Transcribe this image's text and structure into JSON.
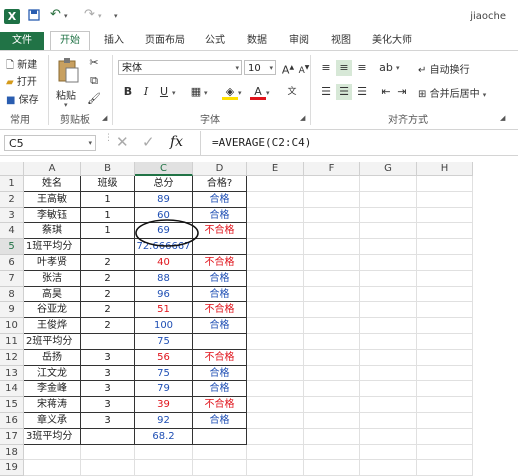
{
  "titlebar": {
    "app_icon": "X",
    "user": "jiaoche",
    "icons": [
      "excel-app-icon",
      "save-icon",
      "undo-icon",
      "redo-icon",
      "customize-qat-icon"
    ]
  },
  "tabs": [
    "文件",
    "开始",
    "插入",
    "页面布局",
    "公式",
    "数据",
    "审阅",
    "视图",
    "美化大师"
  ],
  "ribbon": {
    "new_label": "新建",
    "open_label": "打开",
    "save_label": "保存",
    "group_common": "常用",
    "paste_label": "粘贴",
    "group_clipboard": "剪贴板",
    "font_name": "宋体",
    "font_size": "10",
    "group_font": "字体",
    "wrap_label": "自动换行",
    "merge_label": "合并后居中",
    "group_alignment": "对齐方式"
  },
  "formula_bar": {
    "name_box": "C5",
    "fx": "fx",
    "formula": "=AVERAGE(C2:C4)"
  },
  "sheet": {
    "columns": [
      "A",
      "B",
      "C",
      "D",
      "E",
      "F",
      "G",
      "H"
    ],
    "selected_column": "C",
    "selected_row": 5,
    "rows": [
      {
        "n": "1",
        "a": "姓名",
        "b": "班级",
        "c": "总分",
        "d": "合格?",
        "c_color": "",
        "d_color": ""
      },
      {
        "n": "2",
        "a": "王高敏",
        "b": "1",
        "c": "89",
        "d": "合格",
        "c_color": "blue",
        "d_color": "blue"
      },
      {
        "n": "3",
        "a": "李敏钰",
        "b": "1",
        "c": "60",
        "d": "合格",
        "c_color": "blue",
        "d_color": "blue"
      },
      {
        "n": "4",
        "a": "蔡琪",
        "b": "1",
        "c": "69",
        "d": "不合格",
        "c_color": "blue",
        "d_color": "red"
      },
      {
        "n": "5",
        "a": "1班平均分",
        "b": "",
        "c": "72.666667",
        "d": "",
        "c_color": "blue",
        "d_color": ""
      },
      {
        "n": "6",
        "a": "叶孝贤",
        "b": "2",
        "c": "40",
        "d": "不合格",
        "c_color": "red",
        "d_color": "red"
      },
      {
        "n": "7",
        "a": "张洁",
        "b": "2",
        "c": "88",
        "d": "合格",
        "c_color": "blue",
        "d_color": "blue"
      },
      {
        "n": "8",
        "a": "高昊",
        "b": "2",
        "c": "96",
        "d": "合格",
        "c_color": "blue",
        "d_color": "blue"
      },
      {
        "n": "9",
        "a": "谷亚龙",
        "b": "2",
        "c": "51",
        "d": "不合格",
        "c_color": "red",
        "d_color": "red"
      },
      {
        "n": "10",
        "a": "王俊烨",
        "b": "2",
        "c": "100",
        "d": "合格",
        "c_color": "blue",
        "d_color": "blue"
      },
      {
        "n": "11",
        "a": "2班平均分",
        "b": "",
        "c": "75",
        "d": "",
        "c_color": "blue",
        "d_color": ""
      },
      {
        "n": "12",
        "a": "岳扬",
        "b": "3",
        "c": "56",
        "d": "不合格",
        "c_color": "red",
        "d_color": "red"
      },
      {
        "n": "13",
        "a": "江文龙",
        "b": "3",
        "c": "75",
        "d": "合格",
        "c_color": "blue",
        "d_color": "blue"
      },
      {
        "n": "14",
        "a": "李金峰",
        "b": "3",
        "c": "79",
        "d": "合格",
        "c_color": "blue",
        "d_color": "blue"
      },
      {
        "n": "15",
        "a": "宋蒋涛",
        "b": "3",
        "c": "39",
        "d": "不合格",
        "c_color": "red",
        "d_color": "red"
      },
      {
        "n": "16",
        "a": "章义承",
        "b": "3",
        "c": "92",
        "d": "合格",
        "c_color": "blue",
        "d_color": "blue"
      },
      {
        "n": "17",
        "a": "3班平均分",
        "b": "",
        "c": "68.2",
        "d": "",
        "c_color": "blue",
        "d_color": ""
      },
      {
        "n": "18",
        "a": "",
        "b": "",
        "c": "",
        "d": "",
        "c_color": "",
        "d_color": ""
      },
      {
        "n": "19",
        "a": "",
        "b": "",
        "c": "",
        "d": "",
        "c_color": "",
        "d_color": ""
      }
    ]
  },
  "colors": {
    "accent": "#217346",
    "blue_text": "#1f4fb4",
    "red_text": "#e0141c"
  }
}
